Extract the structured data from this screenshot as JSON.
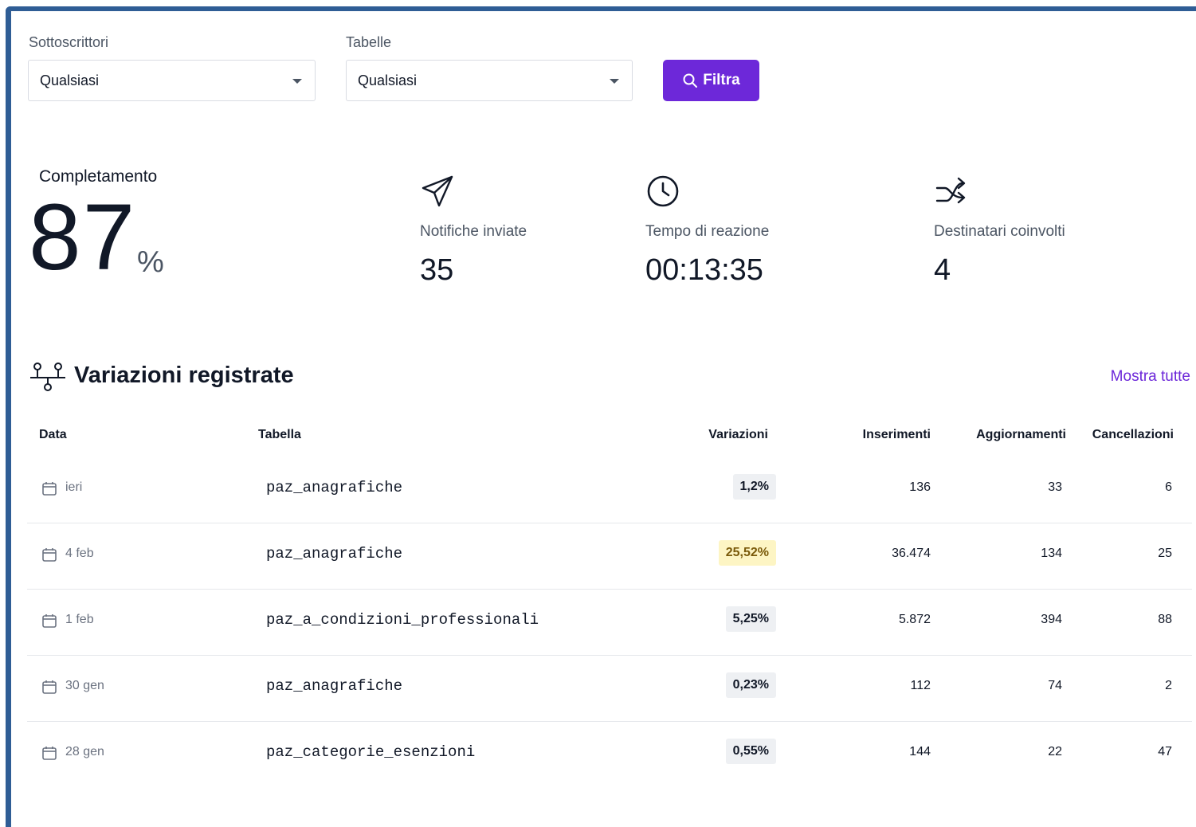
{
  "filters": {
    "subscribers": {
      "label": "Sottoscrittori",
      "value": "Qualsiasi"
    },
    "tables": {
      "label": "Tabelle",
      "value": "Qualsiasi"
    },
    "button_label": "Filtra"
  },
  "stats": {
    "completion": {
      "label": "Completamento",
      "value": "87",
      "unit": "%"
    },
    "notifications": {
      "label": "Notifiche inviate",
      "value": "35",
      "icon": "paper-plane-icon"
    },
    "reaction_time": {
      "label": "Tempo di reazione",
      "value": "00:13:35",
      "icon": "clock-icon"
    },
    "recipients": {
      "label": "Destinatari coinvolti",
      "value": "4",
      "icon": "arrows-split-icon"
    }
  },
  "section": {
    "title": "Variazioni registrate",
    "show_all": "Mostra tutte",
    "icon": "git-branch-icon"
  },
  "table": {
    "headers": {
      "date": "Data",
      "table": "Tabella",
      "changes": "Variazioni",
      "inserts": "Inserimenti",
      "updates": "Aggiornamenti",
      "deletes": "Cancellazioni"
    },
    "rows": [
      {
        "date": "ieri",
        "table": "paz_anagrafiche",
        "changes": "1,2%",
        "inserts": "136",
        "updates": "33",
        "deletes": "6",
        "highlight": false
      },
      {
        "date": "4 feb",
        "table": "paz_anagrafiche",
        "changes": "25,52%",
        "inserts": "36.474",
        "updates": "134",
        "deletes": "25",
        "highlight": true
      },
      {
        "date": "1 feb",
        "table": "paz_a_condizioni_professionali",
        "changes": "5,25%",
        "inserts": "5.872",
        "updates": "394",
        "deletes": "88",
        "highlight": false
      },
      {
        "date": "30 gen",
        "table": "paz_anagrafiche",
        "changes": "0,23%",
        "inserts": "112",
        "updates": "74",
        "deletes": "2",
        "highlight": false
      },
      {
        "date": "28 gen",
        "table": "paz_categorie_esenzioni",
        "changes": "0,55%",
        "inserts": "144",
        "updates": "22",
        "deletes": "47",
        "highlight": false
      }
    ]
  },
  "colors": {
    "accent": "#6d28d9",
    "frame": "#2f5d95",
    "highlight_bg": "#fdf5c4"
  }
}
